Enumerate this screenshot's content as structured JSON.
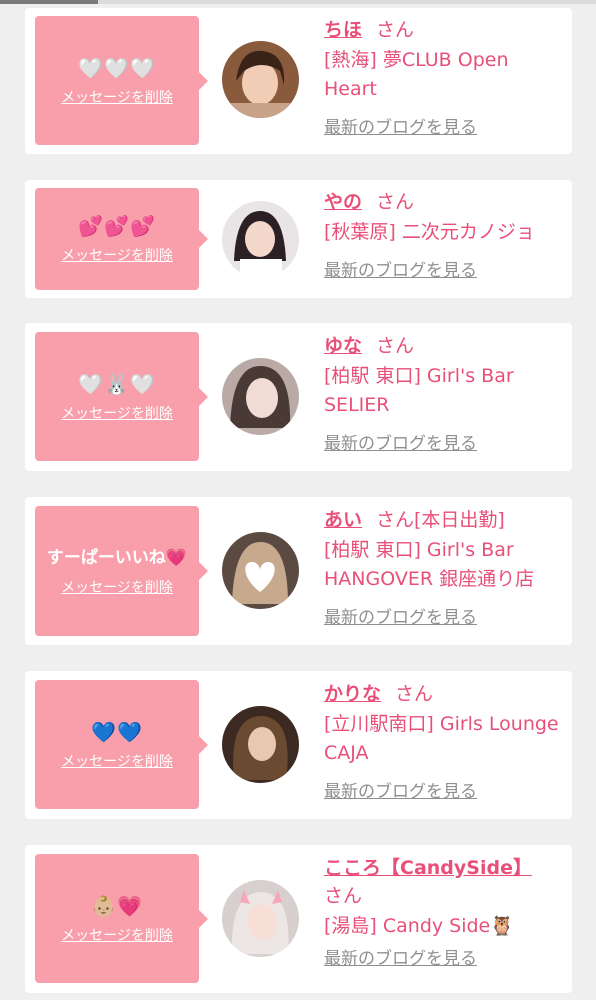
{
  "delete_label": "メッセージを削除",
  "blog_label": "最新のブログを見る",
  "cards": [
    {
      "message": "🤍🤍🤍",
      "name": "ちほ",
      "suffix": "さん",
      "shop": "[熱海] 夢CLUB Open Heart",
      "avatar": "avatar-girl-1"
    },
    {
      "message": "💕💕💕",
      "name": "やの",
      "suffix": "さん",
      "shop": "[秋葉原] 二次元カノジョ",
      "avatar": "avatar-girl-2"
    },
    {
      "message": "🤍🐰🤍",
      "name": "ゆな",
      "suffix": "さん",
      "shop": "[柏駅 東口] Girl's Bar SELIER",
      "avatar": "avatar-girl-3"
    },
    {
      "message": "すーぱーいいね💗",
      "name": "あい",
      "suffix": "さん[本日出勤]",
      "shop": "[柏駅 東口] Girl's Bar HANGOVER 銀座通り店",
      "avatar": "avatar-girl-4"
    },
    {
      "message": "💙💙",
      "name": "かりな",
      "suffix": "さん",
      "shop": "[立川駅南口] Girls Lounge CAJA",
      "avatar": "avatar-girl-5"
    },
    {
      "message": "👶🏼💗",
      "name": "こころ【CandySide】",
      "suffix": "さん",
      "shop": "[湯島] Candy Side🦉",
      "avatar": "avatar-girl-6"
    }
  ]
}
